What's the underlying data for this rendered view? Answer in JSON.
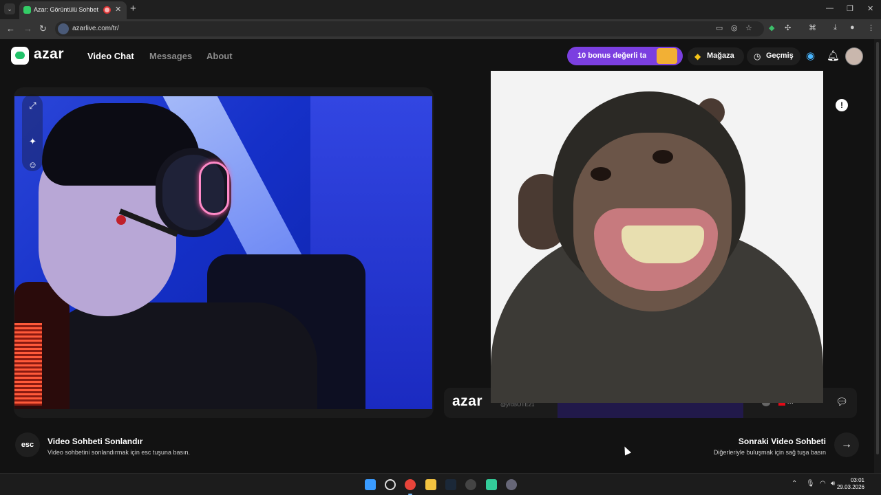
{
  "browser": {
    "tab_title": "Azar: Görüntülü Sohbet & V",
    "tab_close": "✕",
    "new_tab": "+",
    "url": "azarlive.com/tr/",
    "window_controls": [
      "—",
      "❐",
      "✕"
    ]
  },
  "header": {
    "brand": "azar",
    "nav": [
      "Video Chat",
      "Messages",
      "About"
    ],
    "bonus_text": "10 bonus değerli ta",
    "shop_label": "Mağaza",
    "history_label": "Geçmiş"
  },
  "remote": {
    "brand": "azar",
    "subtitle": "@yrcBOTE21",
    "country": "TR"
  },
  "actions": {
    "end_key": "esc",
    "end_title": "Video Sohbeti Sonlandır",
    "end_desc": "Video sohbetini sonlandırmak için esc tuşuna basın.",
    "next_title": "Sonraki Video Sohbeti",
    "next_desc": "Diğerleriyle buluşmak için sağ tuşa basın",
    "next_icon": "→"
  },
  "taskbar": {
    "time": "03:01",
    "date": "29.03.2026"
  },
  "icons": {
    "expand": "expand-icon",
    "magic": "magic-wand-icon",
    "sticker": "sticker-icon",
    "report": "report-shield-icon",
    "chat": "chat-bubble-icon"
  },
  "colors": {
    "accent_purple": "#7b3fe0",
    "background": "#121212",
    "brand_green": "#22c36a"
  }
}
